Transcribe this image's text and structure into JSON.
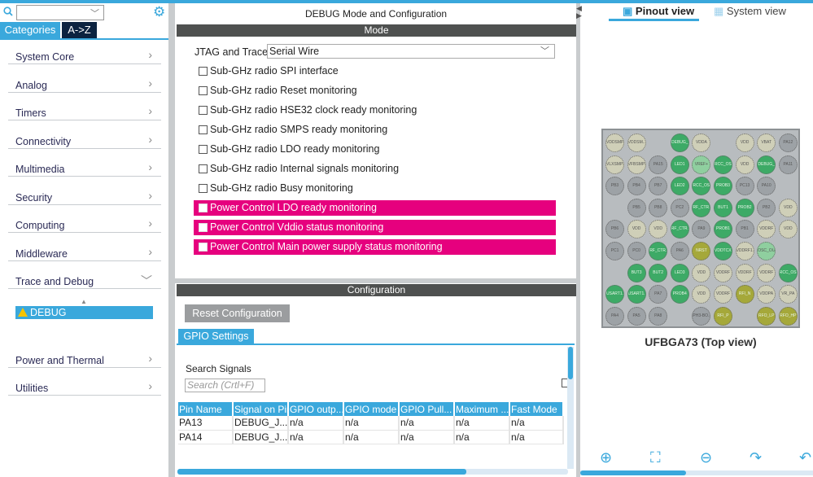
{
  "left": {
    "tabs": [
      "Categories",
      "A->Z"
    ],
    "categories": [
      "System Core",
      "Analog",
      "Timers",
      "Connectivity",
      "Multimedia",
      "Security",
      "Computing",
      "Middleware",
      "Trace and Debug",
      "Power and Thermal",
      "Utilities"
    ],
    "selected_item": "DEBUG"
  },
  "mode": {
    "title": "DEBUG Mode and Configuration",
    "header": "Mode",
    "jtag_label": "JTAG and Trace",
    "jtag_value": "Serial Wire",
    "options": [
      {
        "label": "Sub-GHz radio SPI interface",
        "highlighted": false
      },
      {
        "label": "Sub-GHz radio Reset monitoring",
        "highlighted": false
      },
      {
        "label": "Sub-GHz radio HSE32 clock ready monitoring",
        "highlighted": false
      },
      {
        "label": "Sub-GHz radio SMPS ready monitoring",
        "highlighted": false
      },
      {
        "label": "Sub-GHz radio LDO ready monitoring",
        "highlighted": false
      },
      {
        "label": "Sub-GHz radio Internal signals monitoring",
        "highlighted": false
      },
      {
        "label": "Sub-GHz radio Busy monitoring",
        "highlighted": false
      },
      {
        "label": "Power Control LDO ready monitoring",
        "highlighted": true
      },
      {
        "label": "Power Control Vddio status monitoring",
        "highlighted": true
      },
      {
        "label": "Power Control Main power supply status monitoring",
        "highlighted": true
      }
    ]
  },
  "config": {
    "header": "Configuration",
    "reset_label": "Reset Configuration",
    "tab": "GPIO Settings",
    "search_label": "Search Signals",
    "search_placeholder": "Search (Crtl+F)",
    "columns": [
      "Pin Name",
      "Signal on Pin",
      "GPIO outp...",
      "GPIO mode",
      "GPIO Pull...",
      "Maximum ...",
      "Fast Mode"
    ],
    "rows": [
      [
        "PA13",
        "DEBUG_J...",
        "n/a",
        "n/a",
        "n/a",
        "n/a",
        "n/a"
      ],
      [
        "PA14",
        "DEBUG_J...",
        "n/a",
        "n/a",
        "n/a",
        "n/a",
        "n/a"
      ]
    ]
  },
  "right": {
    "tabs": [
      "Pinout view",
      "System view"
    ],
    "chip_label": "UFBGA73 (Top view)",
    "colors": {
      "g": "#9da2a6",
      "b": "#cfcfb8",
      "G": "#3daa66",
      "y": "#a5a83a",
      "l": "#8fcf9f"
    },
    "pins": [
      [
        "VDDSMPS|b",
        "VDDSM..|b",
        "|",
        "DEBUG_|G",
        "VDDA|b",
        "|",
        "VDD|b",
        "VBAT|b",
        "PA12|g"
      ],
      [
        "VLXSMPS|b",
        "VFBSMPS|b",
        "PA15|g",
        "LED1|G",
        "VREF+|l",
        "RCC_OS..|G",
        "VDD|b",
        "DEBUG_|G",
        "PA11|g"
      ],
      [
        "PB3|g",
        "PB4|g",
        "PB7|g",
        "LED2|G",
        "RCC_OS..|G",
        "PROB3|G",
        "PC13|g",
        "PA10|g",
        "|"
      ],
      [
        "|",
        "PB5|g",
        "PB8|g",
        "PC2|g",
        "RF_CTR..|G",
        "BUT1|G",
        "PROB2|G",
        "PB2|g",
        "VDD|b"
      ],
      [
        "PB6|g",
        "VDD|b",
        "VDD|b",
        "RF_CTR..|G",
        "PA9|g",
        "PROB1|G",
        "PB1|g",
        "VDDRF|b",
        "VDD|b"
      ],
      [
        "PC1|g",
        "PC0|g",
        "RF_CTR..|G",
        "PA6|g",
        "NRST|y",
        "VDDTCX..|G",
        "VDDRF1..|b",
        "OSC_OU..|l",
        "|"
      ],
      [
        "|",
        "BUT3|G",
        "BUT2|G",
        "LED3|G",
        "VDD|b",
        "VDDRF|b",
        "VDDRF|b",
        "VDDRF|b",
        "RCC_OS..|G"
      ],
      [
        "USART1..|G",
        "USART1..|G",
        "PA7|g",
        "PROB4|G",
        "VDD|b",
        "VDDRF|b",
        "RFI_N|y",
        "VDDPA|b",
        "VR_PA|b"
      ],
      [
        "PA4|g",
        "PA5|g",
        "PA8|g",
        "|",
        "PH3-BO..|g",
        "RFI_P|y",
        "|",
        "RFO_LP|y",
        "RFO_HP|y"
      ]
    ]
  }
}
